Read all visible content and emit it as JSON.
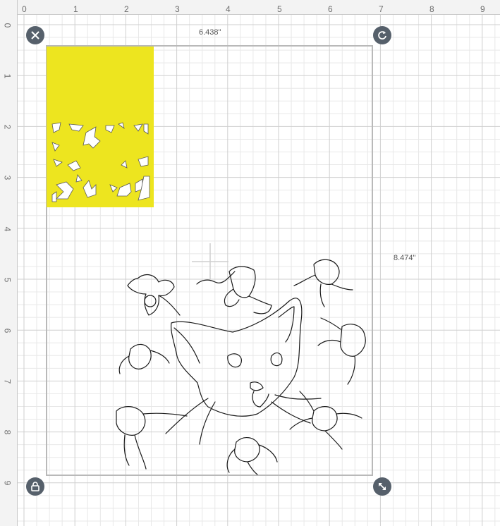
{
  "rulers": {
    "top": [
      "0",
      "1",
      "2",
      "3",
      "4",
      "5",
      "6",
      "7",
      "8",
      "9"
    ],
    "left": [
      "0",
      "1",
      "2",
      "3",
      "4",
      "5",
      "6",
      "7",
      "8",
      "9"
    ]
  },
  "selection": {
    "width_label": "6.438\"",
    "height_label": "8.474\""
  },
  "handles": {
    "delete": "close-icon",
    "rotate": "rotate-icon",
    "lock": "lock-icon",
    "resize": "resize-icon"
  },
  "colors": {
    "yellow_shape": "#ede51f",
    "handle": "#56606b",
    "grid_minor": "#e6e6e6",
    "grid_major": "#cfcfcf",
    "line_art": "#1a1a1a"
  }
}
